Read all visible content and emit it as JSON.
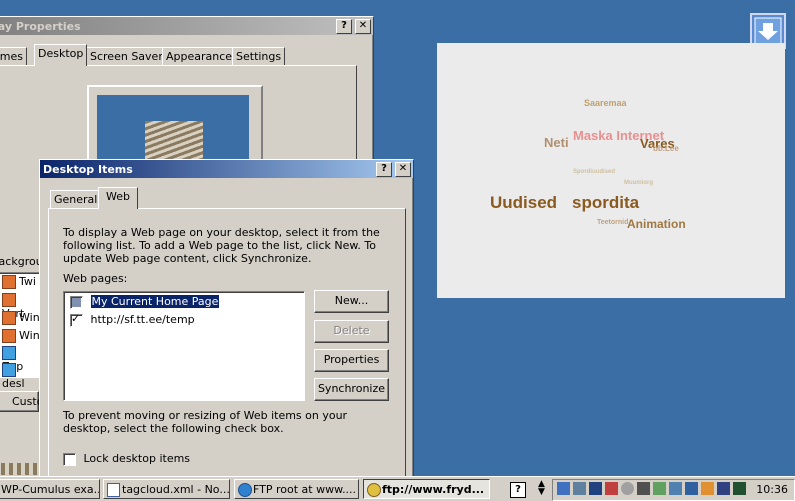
{
  "display_props": {
    "title": "lay Properties",
    "tabs": [
      "emes",
      "Desktop",
      "Screen Saver",
      "Appearance",
      "Settings"
    ],
    "background_label": "Backgrou",
    "bg_items": [
      "Twi",
      "Vort",
      "Win",
      "Win",
      "Zap",
      "desl"
    ],
    "customize_label": "Custo"
  },
  "dialog": {
    "title": "Desktop Items",
    "help": "?",
    "close": "X",
    "tabs": [
      "General",
      "Web"
    ],
    "description": "To display a Web page on your desktop, select it from the following list. To add a Web page to the list, click New.  To update Web page content, click Synchronize.",
    "web_pages_label": "Web pages:",
    "web_pages": [
      {
        "label": "My Current Home Page",
        "checked": false,
        "selected": true
      },
      {
        "label": "http://sf.tt.ee/temp",
        "checked": true,
        "selected": false
      }
    ],
    "buttons": {
      "new": "New...",
      "delete": "Delete",
      "properties": "Properties",
      "synchronize": "Synchronize"
    },
    "lock_text": "To prevent moving or resizing of Web items on your desktop, select the following check box.",
    "lock_label": "Lock desktop items"
  },
  "tagcloud": {
    "words": [
      {
        "text": "Saaremaa",
        "color": "#c0a070"
      },
      {
        "text": "Neti",
        "color": "#b09070"
      },
      {
        "text": "Maska Internet",
        "color": "#e89090"
      },
      {
        "text": "Vares",
        "color": "#8a5a20"
      },
      {
        "text": "bb.Lee",
        "color": "#c0a080"
      },
      {
        "text": "Spordiuudised",
        "color": "#d0c0a0"
      },
      {
        "text": "Muumiorg",
        "color": "#d0c0a0"
      },
      {
        "text": "Uudised",
        "color": "#8a5a20"
      },
      {
        "text": "spordita",
        "color": "#8a5a20"
      },
      {
        "text": "Teetornid",
        "color": "#c0a080"
      },
      {
        "text": "Animation",
        "color": "#a07840"
      }
    ]
  },
  "taskbar": {
    "tasks": [
      "WP-Cumulus exa...",
      "tagcloud.xml - No...",
      "FTP root at www....",
      "ftp://www.fryd..."
    ],
    "clock": "10:36"
  }
}
